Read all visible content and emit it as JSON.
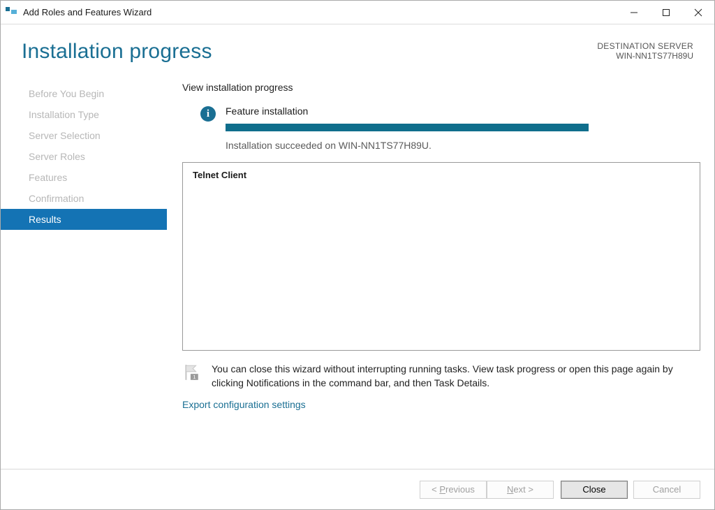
{
  "title": "Add Roles and Features Wizard",
  "header": {
    "page_title": "Installation progress",
    "dest_label": "DESTINATION SERVER",
    "dest_value": "WIN-NN1TS77H89U"
  },
  "sidebar": {
    "items": [
      {
        "label": "Before You Begin"
      },
      {
        "label": "Installation Type"
      },
      {
        "label": "Server Selection"
      },
      {
        "label": "Server Roles"
      },
      {
        "label": "Features"
      },
      {
        "label": "Confirmation"
      },
      {
        "label": "Results"
      }
    ],
    "active_index": 6
  },
  "main": {
    "subhead": "View installation progress",
    "status_text": "Feature installation",
    "result_text": "Installation succeeded on WIN-NN1TS77H89U.",
    "feature_name": "Telnet Client",
    "hint_text": "You can close this wizard without interrupting running tasks. View task progress or open this page again by clicking Notifications in the command bar, and then Task Details.",
    "export_link": "Export configuration settings"
  },
  "footer": {
    "previous": "Previous",
    "next": "Next",
    "close": "Close",
    "cancel": "Cancel"
  },
  "colors": {
    "accent": "#1a6f93",
    "sidebar_active": "#1473b4"
  }
}
